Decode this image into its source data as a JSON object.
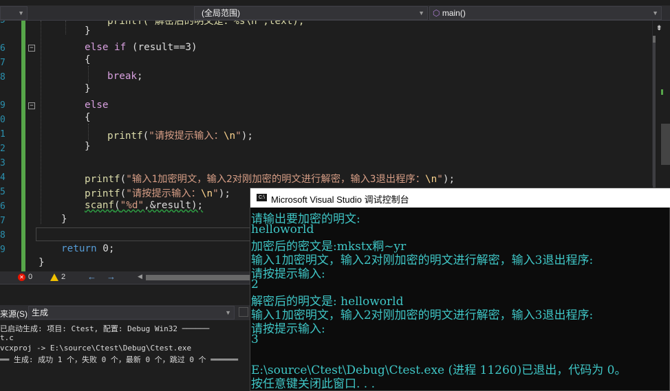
{
  "navbar": {
    "scope": "(全局范围)",
    "function": "main()"
  },
  "gutter_numbers": [
    "5",
    "6",
    "7",
    "8",
    "9",
    "0",
    "1",
    "2",
    "3",
    "4",
    "5",
    "6",
    "7",
    "8",
    "9"
  ],
  "code": {
    "l0": "printf(\"解密后的明文是：%s\\n\",text);",
    "l1": "}",
    "l2a": "else if",
    "l2b": " (result==3)",
    "l3": "{",
    "l4a": "break",
    "l4b": ";",
    "l5": "}",
    "l6": "else",
    "l7": "{",
    "l8a": "printf",
    "l8b": "(",
    "l8c": "\"请按提示输入：",
    "l8d": "\\n",
    "l8e": "\"",
    "l8f": ");",
    "l9": "}",
    "l10a": "printf",
    "l10b": "(",
    "l10c": "\"输入1加密明文，输入2对刚加密的明文进行解密，输入3退出程序：",
    "l10d": "\\n",
    "l10e": "\"",
    "l10f": ");",
    "l11a": "printf",
    "l11b": "(",
    "l11c": "\"请按提示输入：",
    "l11d": "\\n",
    "l11e": "\"",
    "l11f": ");",
    "l12a": "scanf",
    "l12b": "(",
    "l12c": "\"%d\"",
    "l12d": ",&result);",
    "l13": "}",
    "l14a": "return",
    "l14b": " 0;",
    "l15": "}"
  },
  "status": {
    "errors": "0",
    "warnings": "2"
  },
  "output_panel": {
    "source_label": "来源(S):",
    "source_value": "生成",
    "lines": [
      "已启动生成: 项目: Ctest, 配置: Debug Win32 ──────",
      "t.c",
      "vcxproj -> E:\\source\\Ctest\\Debug\\Ctest.exe",
      "══ 生成: 成功 1 个，失败 0 个，最新 0 个，跳过 0 个 ══════"
    ]
  },
  "console": {
    "title": "Microsoft Visual Studio 调试控制台",
    "lines": [
      "请输出要加密的明文:",
      "helloworld",
      "加密后的密文是:mkstx粡~yr",
      "输入1加密明文，输入2对刚加密的明文进行解密，输入3退出程序:",
      "请按提示输入:",
      "2",
      "解密后的明文是: helloworld",
      "输入1加密明文，输入2对刚加密的明文进行解密，输入3退出程序:",
      "请按提示输入:",
      "3",
      "",
      "E:\\source\\Ctest\\Debug\\Ctest.exe (进程 11260)已退出，代码为 0。",
      "按任意键关闭此窗口. . ."
    ]
  },
  "colors": {
    "console_text": "#3fc6c6",
    "keyword": "#569cd6",
    "control_keyword": "#d8a0df",
    "string": "#d69d85"
  }
}
